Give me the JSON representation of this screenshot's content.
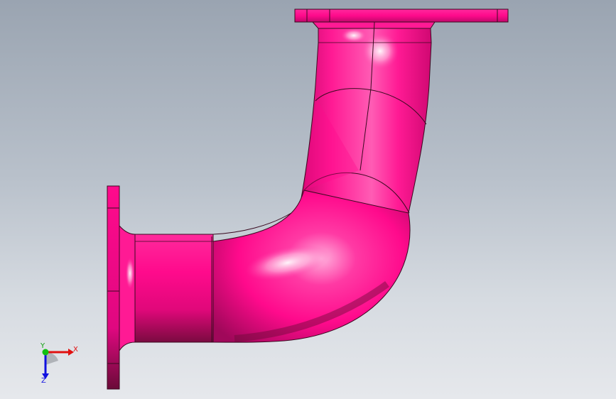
{
  "viewport": {
    "background_top": "#9aa4b1",
    "background_bottom": "#e6e8ec"
  },
  "model": {
    "part": "pipe-elbow-with-flanges",
    "color": "#ff0a8c",
    "color_dark": "#8a0a45",
    "color_highlight": "#ffe0f2",
    "edge_color": "#1a0a10"
  },
  "triad": {
    "x_label": "X",
    "y_label": "Y",
    "z_label": "Z",
    "x_color": "#e01010",
    "y_color": "#10c010",
    "z_color": "#1010e0"
  }
}
